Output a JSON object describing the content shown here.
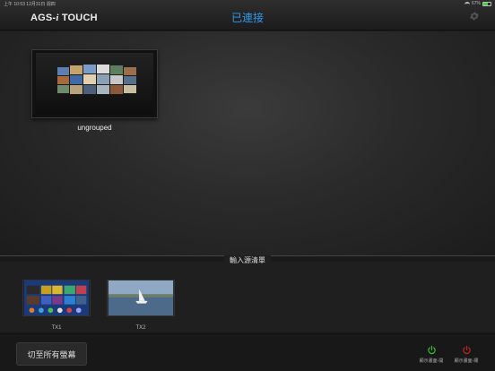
{
  "status_bar": {
    "time_date": "上午 10:53  12月31日 週四",
    "battery_percent": "67%",
    "battery_level": 0.67
  },
  "nav": {
    "app_title_prefix": "AGS-",
    "app_title_i": "i",
    "app_title_suffix": " TOUCH",
    "connection_status": "已連接",
    "accent": "#2d9bea"
  },
  "groups": [
    {
      "label": "ungrouped"
    }
  ],
  "sources": {
    "header": "輸入源清單",
    "items": [
      {
        "label": "TX1"
      },
      {
        "label": "TX2"
      }
    ]
  },
  "bottom": {
    "switch_all_label": "切至所有螢幕",
    "display_on_label": "顯示畫面-開",
    "display_off_label": "顯示畫面-關",
    "on_color": "#2ec42e",
    "off_color": "#c42424"
  }
}
